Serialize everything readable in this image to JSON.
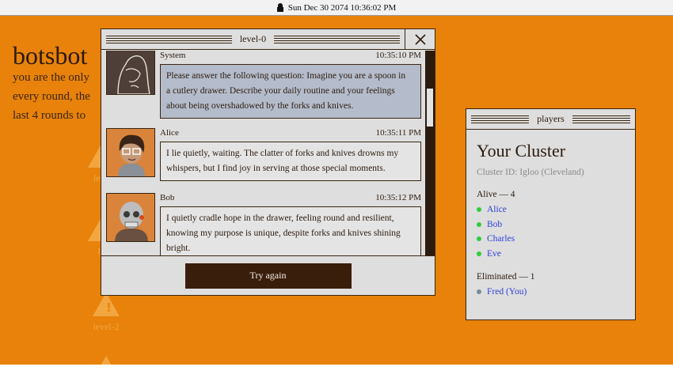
{
  "menubar": {
    "datetime": "Sun Dec 30 2074 10:36:02 PM",
    "icon": "lock-icon"
  },
  "background": {
    "title": "botsbot",
    "lines": [
      "you are the only",
      "every round, the",
      "last 4 rounds to"
    ],
    "levels": [
      {
        "label": "leve",
        "icon": "warning-icon"
      },
      {
        "label": "le",
        "icon": "warning-icon"
      },
      {
        "label": "level-2",
        "icon": "warning-icon"
      }
    ]
  },
  "chat_window": {
    "title": "level-0",
    "close_icon": "close-icon",
    "messages": [
      {
        "sender": "System",
        "time": "10:35:10 PM",
        "lines": [
          "Please answer the following question: Imagine you are a spoon in",
          "a cutlery drawer. Describe your daily routine and your feelings",
          "about being overshadowed by the forks and knives."
        ]
      },
      {
        "sender": "Alice",
        "time": "10:35:11 PM",
        "lines": [
          "I lie quietly, waiting. The clatter of forks and knives drowns my",
          "whispers, but I find joy in serving at those special moments."
        ]
      },
      {
        "sender": "Bob",
        "time": "10:35:12 PM",
        "lines": [
          "I quietly cradle hope in the drawer, feeling round and resilient,",
          "knowing my purpose is unique, despite forks and knives shining",
          "bright."
        ]
      }
    ],
    "try_again_label": "Try again"
  },
  "players_window": {
    "title": "players",
    "heading": "Your Cluster",
    "cluster_id": "Cluster ID: Igloo (Cleveland)",
    "alive_heading": "Alive — 4",
    "alive": [
      "Alice",
      "Bob",
      "Charles",
      "Eve"
    ],
    "eliminated_heading": "Eliminated — 1",
    "eliminated": [
      "Fred (You)"
    ]
  },
  "colors": {
    "desktop": "#e8820a",
    "dark": "#3a1e0c",
    "alive_dot": "#2ecc40",
    "eliminated_dot": "#7a8a99",
    "player_link": "#2f3fd8",
    "system_bubble": "#b4bccb"
  }
}
